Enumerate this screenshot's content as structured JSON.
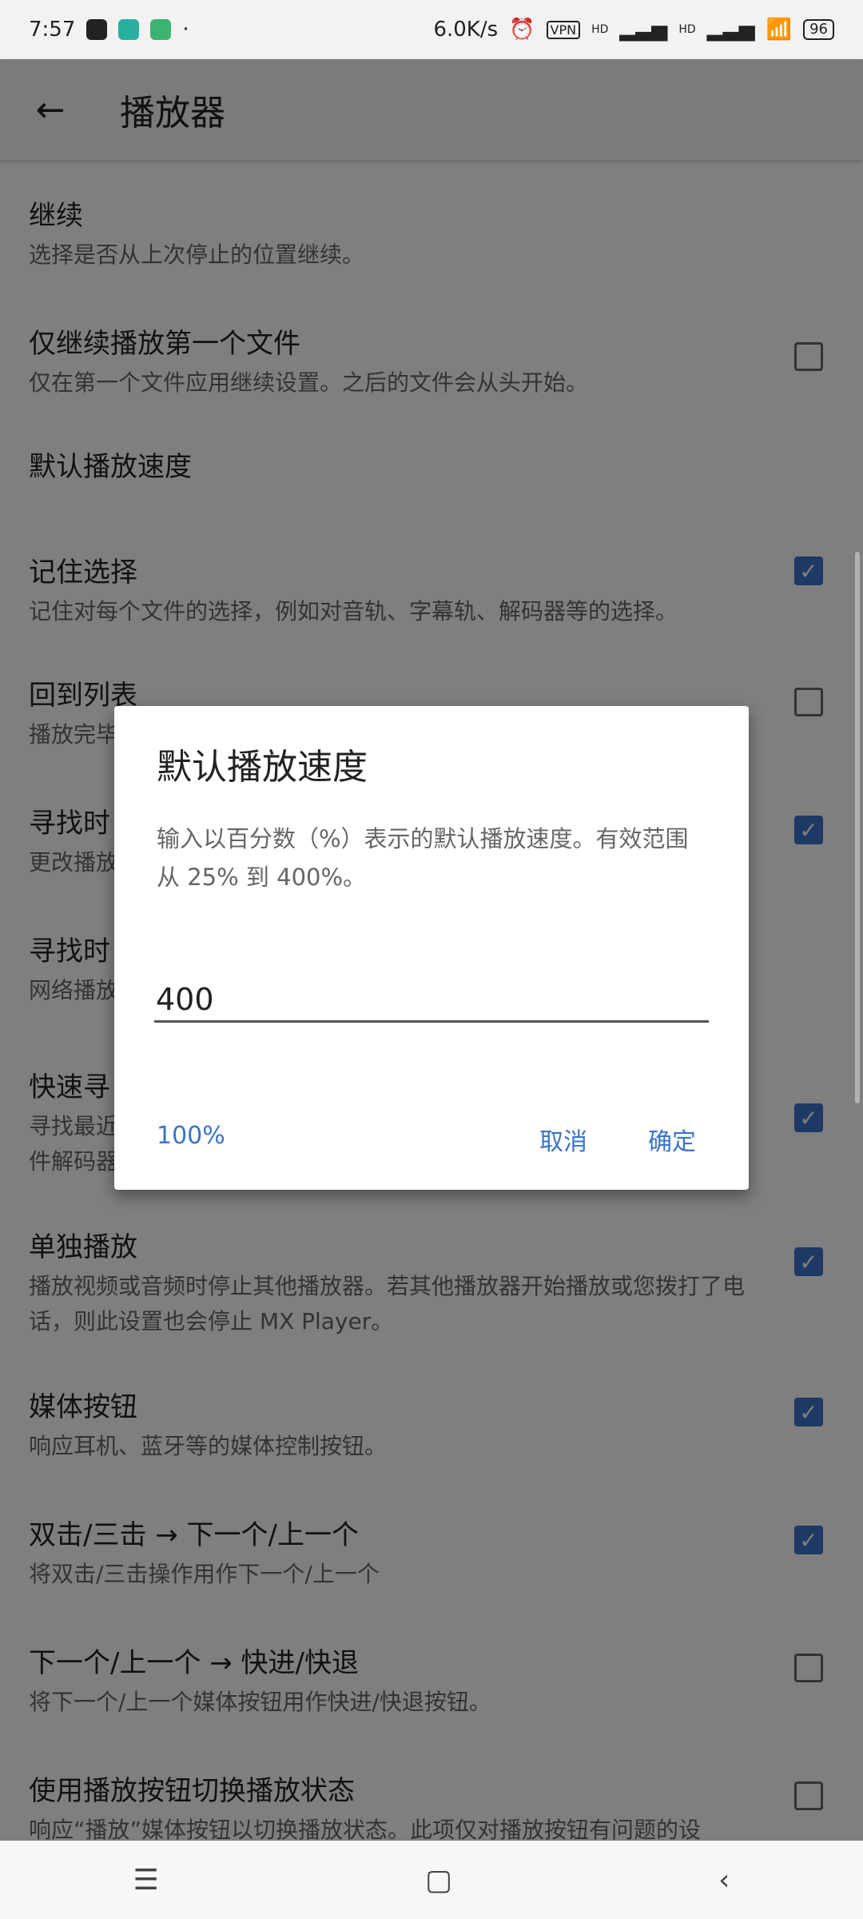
{
  "status_bar": {
    "time": "7:57",
    "net_speed": "6.0K/s",
    "vpn": "VPN",
    "hd1": "HD",
    "hd2": "HD",
    "battery": "96"
  },
  "app_bar": {
    "title": "播放器"
  },
  "list": [
    {
      "title": "继续",
      "subtitle": "选择是否从上次停止的位置继续。",
      "checkbox": null
    },
    {
      "title": "仅继续播放第一个文件",
      "subtitle": "仅在第一个文件应用继续设置。之后的文件会从头开始。",
      "checkbox": false
    },
    {
      "title": "默认播放速度",
      "subtitle": "",
      "checkbox": null
    },
    {
      "title": "记住选择",
      "subtitle": "记住对每个文件的选择，例如对音轨、字幕轨、解码器等的选择。",
      "checkbox": true
    },
    {
      "title": "回到列表",
      "subtitle": "播放完毕",
      "checkbox": false
    },
    {
      "title": "寻找时",
      "subtitle": "更改播放",
      "checkbox": true
    },
    {
      "title": "寻找时",
      "subtitle": "网络播放",
      "checkbox": null
    },
    {
      "title": "快速寻",
      "subtitle": "寻找最近\n件解码器",
      "checkbox": true
    },
    {
      "title": "单独播放",
      "subtitle": "播放视频或音频时停止其他播放器。若其他播放器开始播放或您拨打了电话，则此设置也会停止 MX Player。",
      "checkbox": true
    },
    {
      "title": "媒体按钮",
      "subtitle": "响应耳机、蓝牙等的媒体控制按钮。",
      "checkbox": true
    },
    {
      "title": "双击/三击 → 下一个/上一个",
      "subtitle": "将双击/三击操作用作下一个/上一个",
      "checkbox": true
    },
    {
      "title": "下一个/上一个 → 快进/快退",
      "subtitle": "将下一个/上一个媒体按钮用作快进/快退按钮。",
      "checkbox": false
    },
    {
      "title": "使用播放按钮切换播放状态",
      "subtitle": "响应“播放”媒体按钮以切换播放状态。此项仅对播放按钮有问题的设",
      "checkbox": false
    }
  ],
  "dialog": {
    "title": "默认播放速度",
    "message": "输入以百分数（%）表示的默认播放速度。有效范围从 25% 到 400%。",
    "input_value": "400",
    "btn_default": "100%",
    "btn_cancel": "取消",
    "btn_ok": "确定"
  },
  "nav": {
    "menu": "☰",
    "home": "▢",
    "back": "‹"
  },
  "colors": {
    "accent": "#3a73c8"
  }
}
